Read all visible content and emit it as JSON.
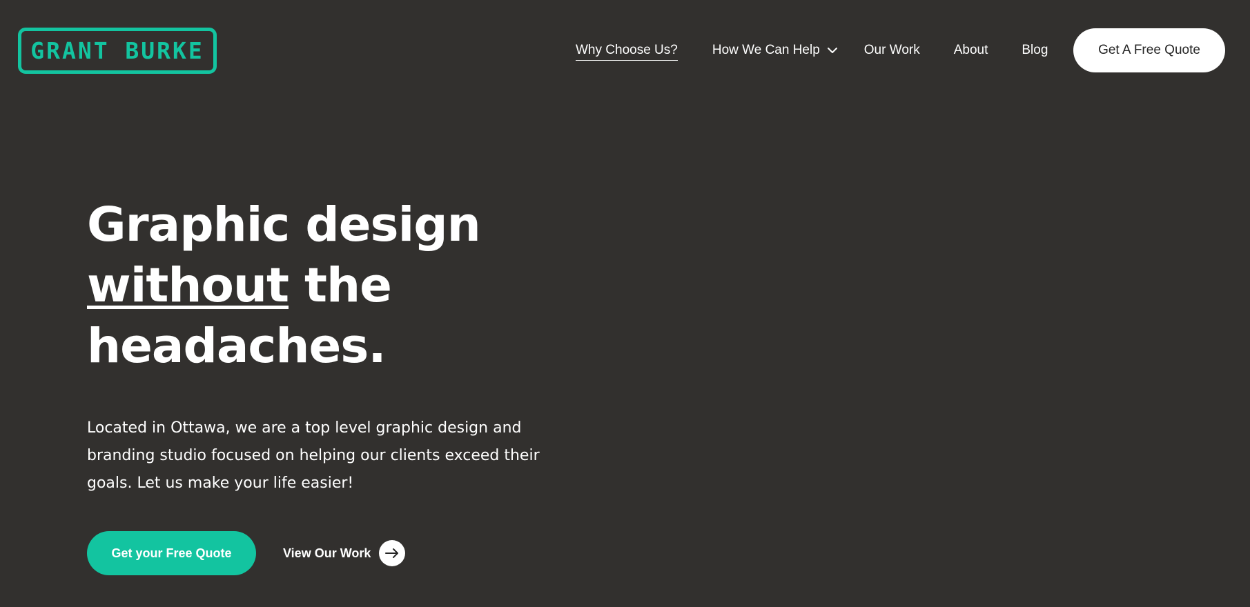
{
  "brand": {
    "logo_text": "GRANT BURKE",
    "accent_color": "#13c4a0",
    "background_color": "#32302e"
  },
  "nav": {
    "items": [
      {
        "label": "Why Choose Us?",
        "active": true,
        "has_dropdown": false
      },
      {
        "label": "How We Can Help",
        "active": false,
        "has_dropdown": true
      },
      {
        "label": "Our Work",
        "active": false,
        "has_dropdown": false
      },
      {
        "label": "About",
        "active": false,
        "has_dropdown": false
      },
      {
        "label": "Blog",
        "active": false,
        "has_dropdown": false
      }
    ],
    "dropdown_icon": "chevron-down-icon",
    "cta_label": "Get A Free Quote"
  },
  "hero": {
    "title_line1": "Graphic design",
    "title_emphasis": "without",
    "title_line2_rest": " the",
    "title_line3": "headaches.",
    "description": "Located in Ottawa, we are a top level graphic design and branding studio focused on helping our clients exceed their goals. Let us make your life easier!",
    "primary_cta": "Get your Free Quote",
    "secondary_cta": "View Our Work",
    "secondary_cta_icon": "arrow-right-icon"
  }
}
